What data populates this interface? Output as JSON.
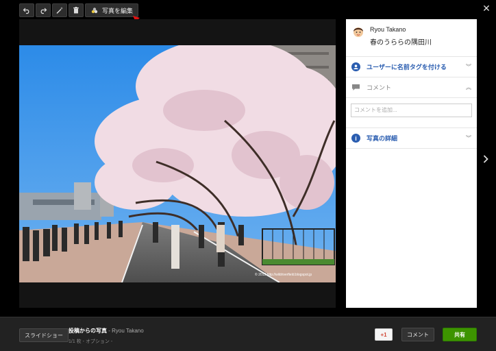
{
  "toolbar": {
    "undo_icon": "undo-icon",
    "redo_icon": "redo-icon",
    "magic_icon": "magic-wand-icon",
    "delete_icon": "trash-icon",
    "edit_label": "写真を編集"
  },
  "viewer": {
    "close_icon": "close-icon",
    "next_icon": "chevron-right-icon",
    "watermark": "© 2013 http://wildriverfield.blogspot.jp"
  },
  "panel": {
    "user_name": "Ryou Takano",
    "photo_title": "春のうららの隅田川",
    "tag_label": "ユーザーに名前タグを付ける",
    "comment_label": "コメント",
    "comment_placeholder": "コメントを追加...",
    "details_label": "写真の詳細",
    "accent": "#2a5db0"
  },
  "bottom": {
    "slideshow_label": "スライドショー",
    "album_title": "投稿からの写真",
    "separator": "-",
    "author": "Ryou Takano",
    "count": "1/1 枚",
    "options": "オプション",
    "plusone_label": "+1",
    "comment_button": "コメント",
    "share_button": "共有",
    "share_color": "#3d9400"
  }
}
